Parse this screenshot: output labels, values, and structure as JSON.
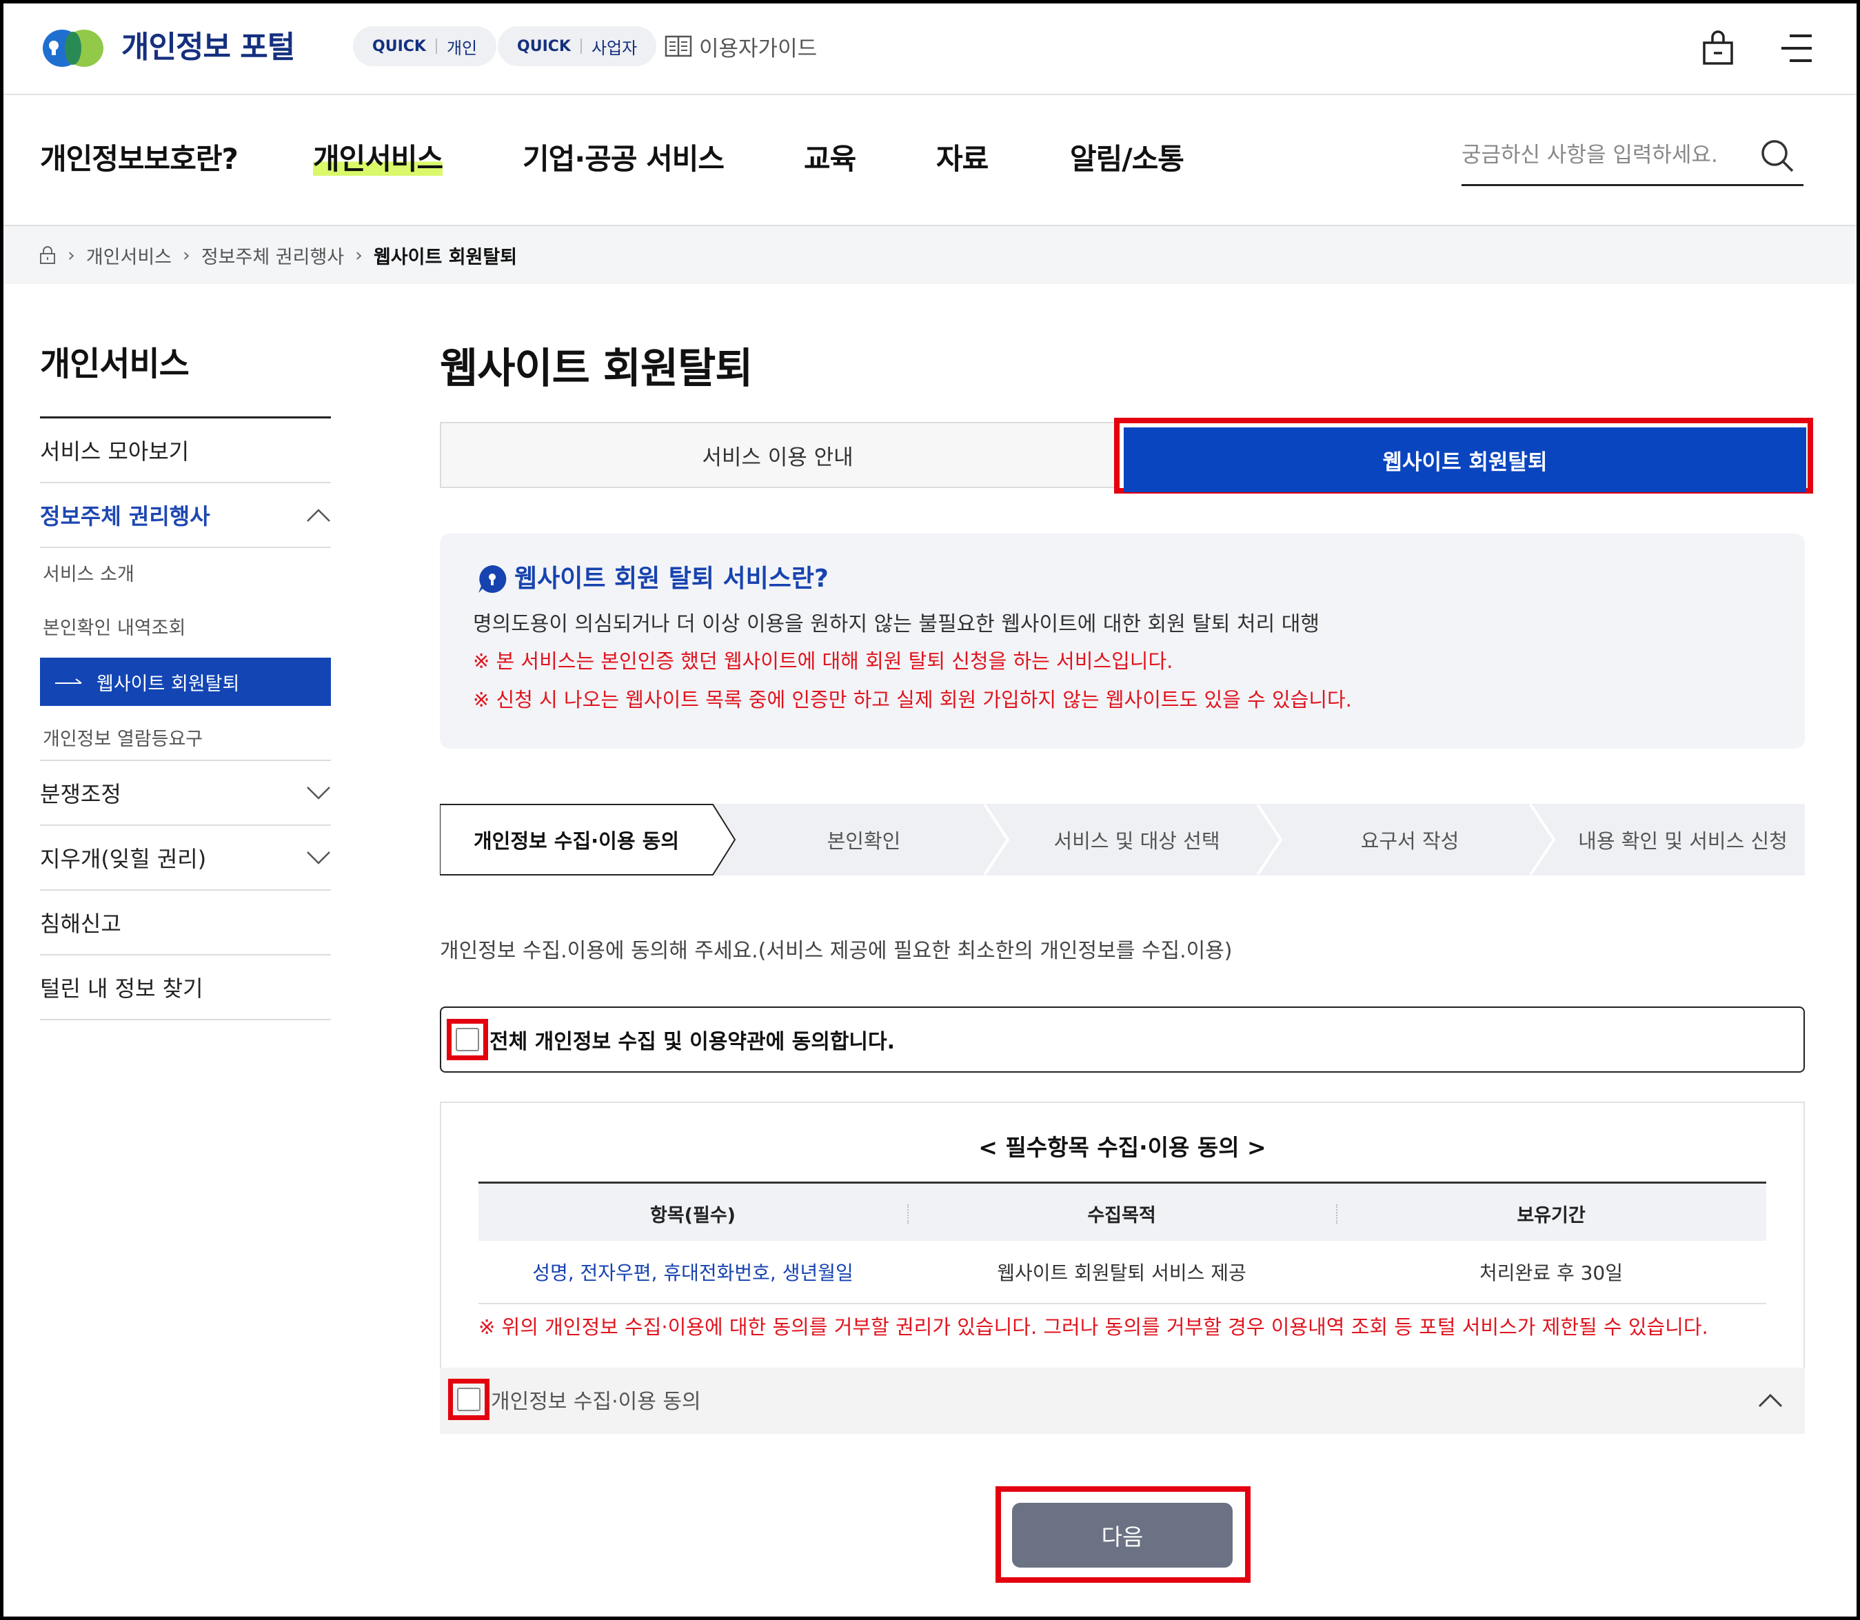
{
  "header": {
    "logo_text": "개인정보 포털",
    "quick_personal": {
      "q": "QUICK",
      "label": "개인"
    },
    "quick_business": {
      "q": "QUICK",
      "label": "사업자"
    },
    "guide_label": "이용자가이드"
  },
  "nav": {
    "items": [
      "개인정보보호란?",
      "개인서비스",
      "기업·공공 서비스",
      "교육",
      "자료",
      "알림/소통"
    ],
    "active_index": 1,
    "search_placeholder": "궁금하신 사항을 입력하세요."
  },
  "breadcrumb": [
    "개인서비스",
    "정보주체 권리행사",
    "웹사이트 회원탈퇴"
  ],
  "sidebar": {
    "title": "개인서비스",
    "items": [
      {
        "label": "서비스 모아보기"
      },
      {
        "label": "정보주체 권리행사",
        "expanded": true
      },
      {
        "label": "분쟁조정"
      },
      {
        "label": "지우개(잊힐 권리)"
      },
      {
        "label": "침해신고"
      },
      {
        "label": "털린 내 정보 찾기"
      }
    ],
    "sub_items": [
      "서비스 소개",
      "본인확인 내역조회",
      "웹사이트 회원탈퇴",
      "개인정보 열람등요구"
    ],
    "active_sub_index": 2
  },
  "main": {
    "title": "웹사이트 회원탈퇴",
    "tabs": [
      "서비스 이용 안내",
      "웹사이트 회원탈퇴"
    ],
    "active_tab": 1,
    "info": {
      "title": "웹사이트 회원 탈퇴 서비스란?",
      "desc": "명의도용이 의심되거나 더 이상 이용을 원하지 않는 불필요한 웹사이트에 대한 회원 탈퇴 처리 대행",
      "note1": "※ 본 서비스는 본인인증 했던 웹사이트에 대해 회원 탈퇴 신청을 하는 서비스입니다.",
      "note2": "※ 신청 시 나오는 웹사이트 목록 중에 인증만 하고 실제 회원 가입하지 않는 웹사이트도 있을 수 있습니다."
    },
    "steps": [
      "개인정보 수집·이용 동의",
      "본인확인",
      "서비스 및 대상 선택",
      "요구서 작성",
      "내용 확인 및 서비스 신청"
    ],
    "current_step": 0,
    "consent_msg": "개인정보 수집.이용에 동의해 주세요.(서비스 제공에 필요한 최소한의 개인정보를 수집.이용)",
    "all_agree_label": "전체 개인정보 수집 및 이용약관에 동의합니다.",
    "terms": {
      "title": "< 필수항목 수집·이용 동의 >",
      "headers": [
        "항목(필수)",
        "수집목적",
        "보유기간"
      ],
      "row": [
        "성명, 전자우편, 휴대전화번호, 생년월일",
        "웹사이트 회원탈퇴 서비스 제공",
        "처리완료 후 30일"
      ],
      "note": "※ 위의 개인정보 수집·이용에 대한 동의를 거부할 권리가 있습니다. 그러나 동의를 거부할 경우 이용내역 조회 등 포털 서비스가 제한될 수 있습니다."
    },
    "consent_checkbox_label": "개인정보 수집·이용 동의",
    "next_label": "다음"
  },
  "colors": {
    "brand_navy": "#15307f",
    "primary_blue": "#0a45c0",
    "highlight_red": "#e3000f",
    "note_red": "#e0141e",
    "nav_highlight": "#d9f96a",
    "button_gray": "#6a7283"
  }
}
